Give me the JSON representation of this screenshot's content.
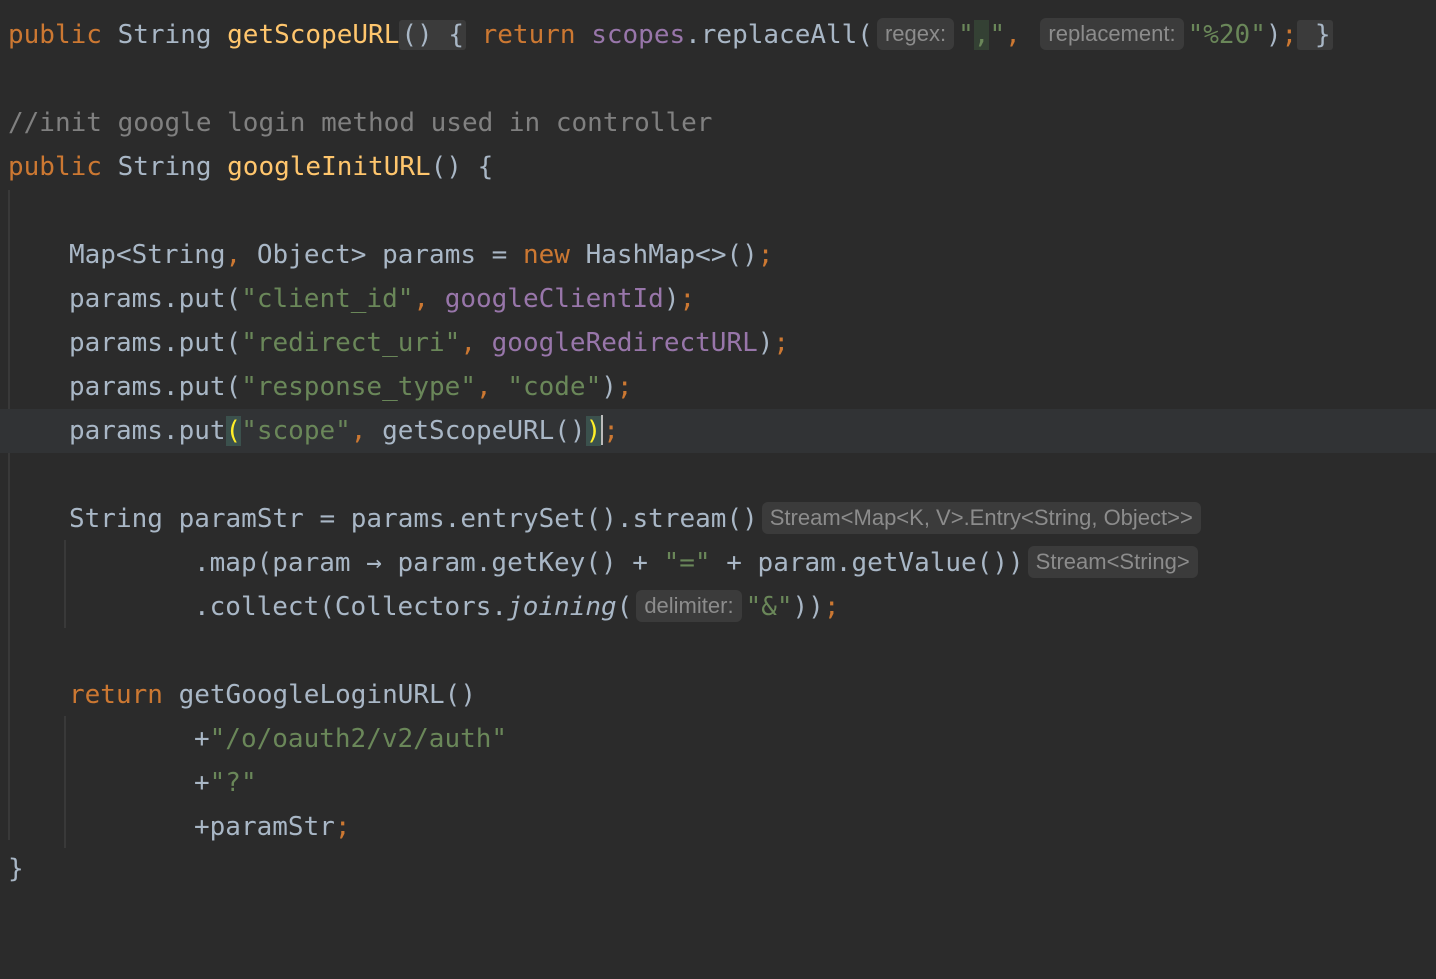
{
  "editor": {
    "l1": {
      "public": "public",
      "type": "String",
      "method": "getScopeURL",
      "parens": "()",
      "open": "{",
      "return": "return",
      "field": "scopes",
      "call": ".replaceAll(",
      "hint1": "regex:",
      "arg1_open": "\"",
      "arg1_comma": ",",
      "arg1_close": "\"",
      "sep": ",",
      "hint2": "replacement:",
      "arg2": "\"%20\"",
      "close_paren": ")",
      "semi": ";",
      "close": "}"
    },
    "l3": {
      "comment": "//init google login method used in controller"
    },
    "l4": {
      "public": "public",
      "type": "String",
      "method": "googleInitURL",
      "rest": "() {"
    },
    "l6": {
      "a": "Map<String",
      "comma": ",",
      "b": " Object> params = ",
      "new": "new",
      "c": " HashMap<>()",
      "semi": ";"
    },
    "l7": {
      "a": "params.put(",
      "str": "\"client_id\"",
      "comma": ",",
      "field": "googleClientId",
      "b": ")",
      "semi": ";"
    },
    "l8": {
      "a": "params.put(",
      "str": "\"redirect_uri\"",
      "comma": ",",
      "field": "googleRedirectURL",
      "b": ")",
      "semi": ";"
    },
    "l9": {
      "a": "params.put(",
      "str1": "\"response_type\"",
      "comma": ",",
      "str2": "\"code\"",
      "b": ")",
      "semi": ";"
    },
    "l10": {
      "a": "params.put",
      "open": "(",
      "str": "\"scope\"",
      "comma": ",",
      "b": " getScopeURL()",
      "close": ")",
      "semi": ";"
    },
    "l12": {
      "a": "String paramStr = params.entrySet().stream()",
      "hint": "Stream<Map<K, V>.Entry<String, Object>>"
    },
    "l13": {
      "a": ".map(param → param.getKey() + ",
      "str": "\"=\"",
      "b": " + param.getValue())",
      "hint": "Stream<String>"
    },
    "l14": {
      "a": ".collect(Collectors.",
      "it": "joining",
      "b": "(",
      "hint": "delimiter:",
      "str": "\"&\"",
      "c": "))",
      "semi": ";"
    },
    "l16": {
      "return": "return",
      "a": " getGoogleLoginURL()"
    },
    "l17": {
      "a": "+",
      "str": "\"/o/oauth2/v2/auth\""
    },
    "l18": {
      "a": "+",
      "str": "\"?\""
    },
    "l19": {
      "a": "+paramStr",
      "semi": ";"
    },
    "l20": {
      "a": "}"
    }
  }
}
